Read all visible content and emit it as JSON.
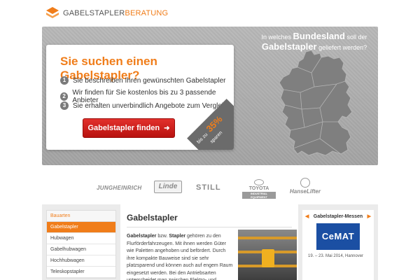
{
  "header": {
    "logo_part1": "GABELSTAPLER",
    "logo_part2": "BERATUNG"
  },
  "hero": {
    "question_line1": "In welches",
    "question_bold1": "Bundesland",
    "question_line1_end": "soll der",
    "question_bold2": "Gabelstapler",
    "question_line2_end": "geliefert werden?",
    "title": "Sie suchen einen Gabelstapler?",
    "steps": [
      {
        "num": "1",
        "text": "Sie beschreiben Ihren gewünschten Gabelstapler"
      },
      {
        "num": "2",
        "text": "Wir finden für Sie kostenlos bis zu 3 passende Anbieter"
      },
      {
        "num": "3",
        "text": "Sie erhalten unverbindlich Angebote zum Vergleich"
      }
    ],
    "cta_label": "Gabelstapler finden",
    "badge_prefix": "bis zu",
    "badge_percent": "35%",
    "badge_suffix": "sparen"
  },
  "brands": {
    "jungheinrich": "JUNGHEINRICH",
    "linde": "Linde",
    "still": "STILL",
    "toyota": "TOYOTA",
    "toyota_sub": "INDUSTRIAL EQUIPMENT",
    "hanselifter": "HanseLifter"
  },
  "sidebar": {
    "heading": "Bauarten",
    "items": [
      "Gabelstapler",
      "Hubwagen",
      "Gabelhubwagen",
      "Hochhubwagen",
      "Teleskopstapler"
    ]
  },
  "main": {
    "title": "Gabelstapler",
    "p_bold1": "Gabelstapler",
    "p_1": " bzw. ",
    "p_bold2": "Stapler",
    "p_2": " gehören zu den Flurförderfahrzeugen. Mit ihnen werden Güter wie Paletten angehoben und befördert. Durch ihre kompakte Bauweise sind sie sehr platzsparend und können auch auf engem Raum eingesetzt werden. Bei den Antriebsarten unterscheidet man zwischen Elektro- und"
  },
  "events": {
    "heading": "Gabelstapler-Messen",
    "logo_text": "CeMAT",
    "date": "19. – 23. Mai 2014, Hannover"
  },
  "colors": {
    "accent": "#f07d1a",
    "cta": "#d0201c",
    "map": "#7d7d7d"
  }
}
